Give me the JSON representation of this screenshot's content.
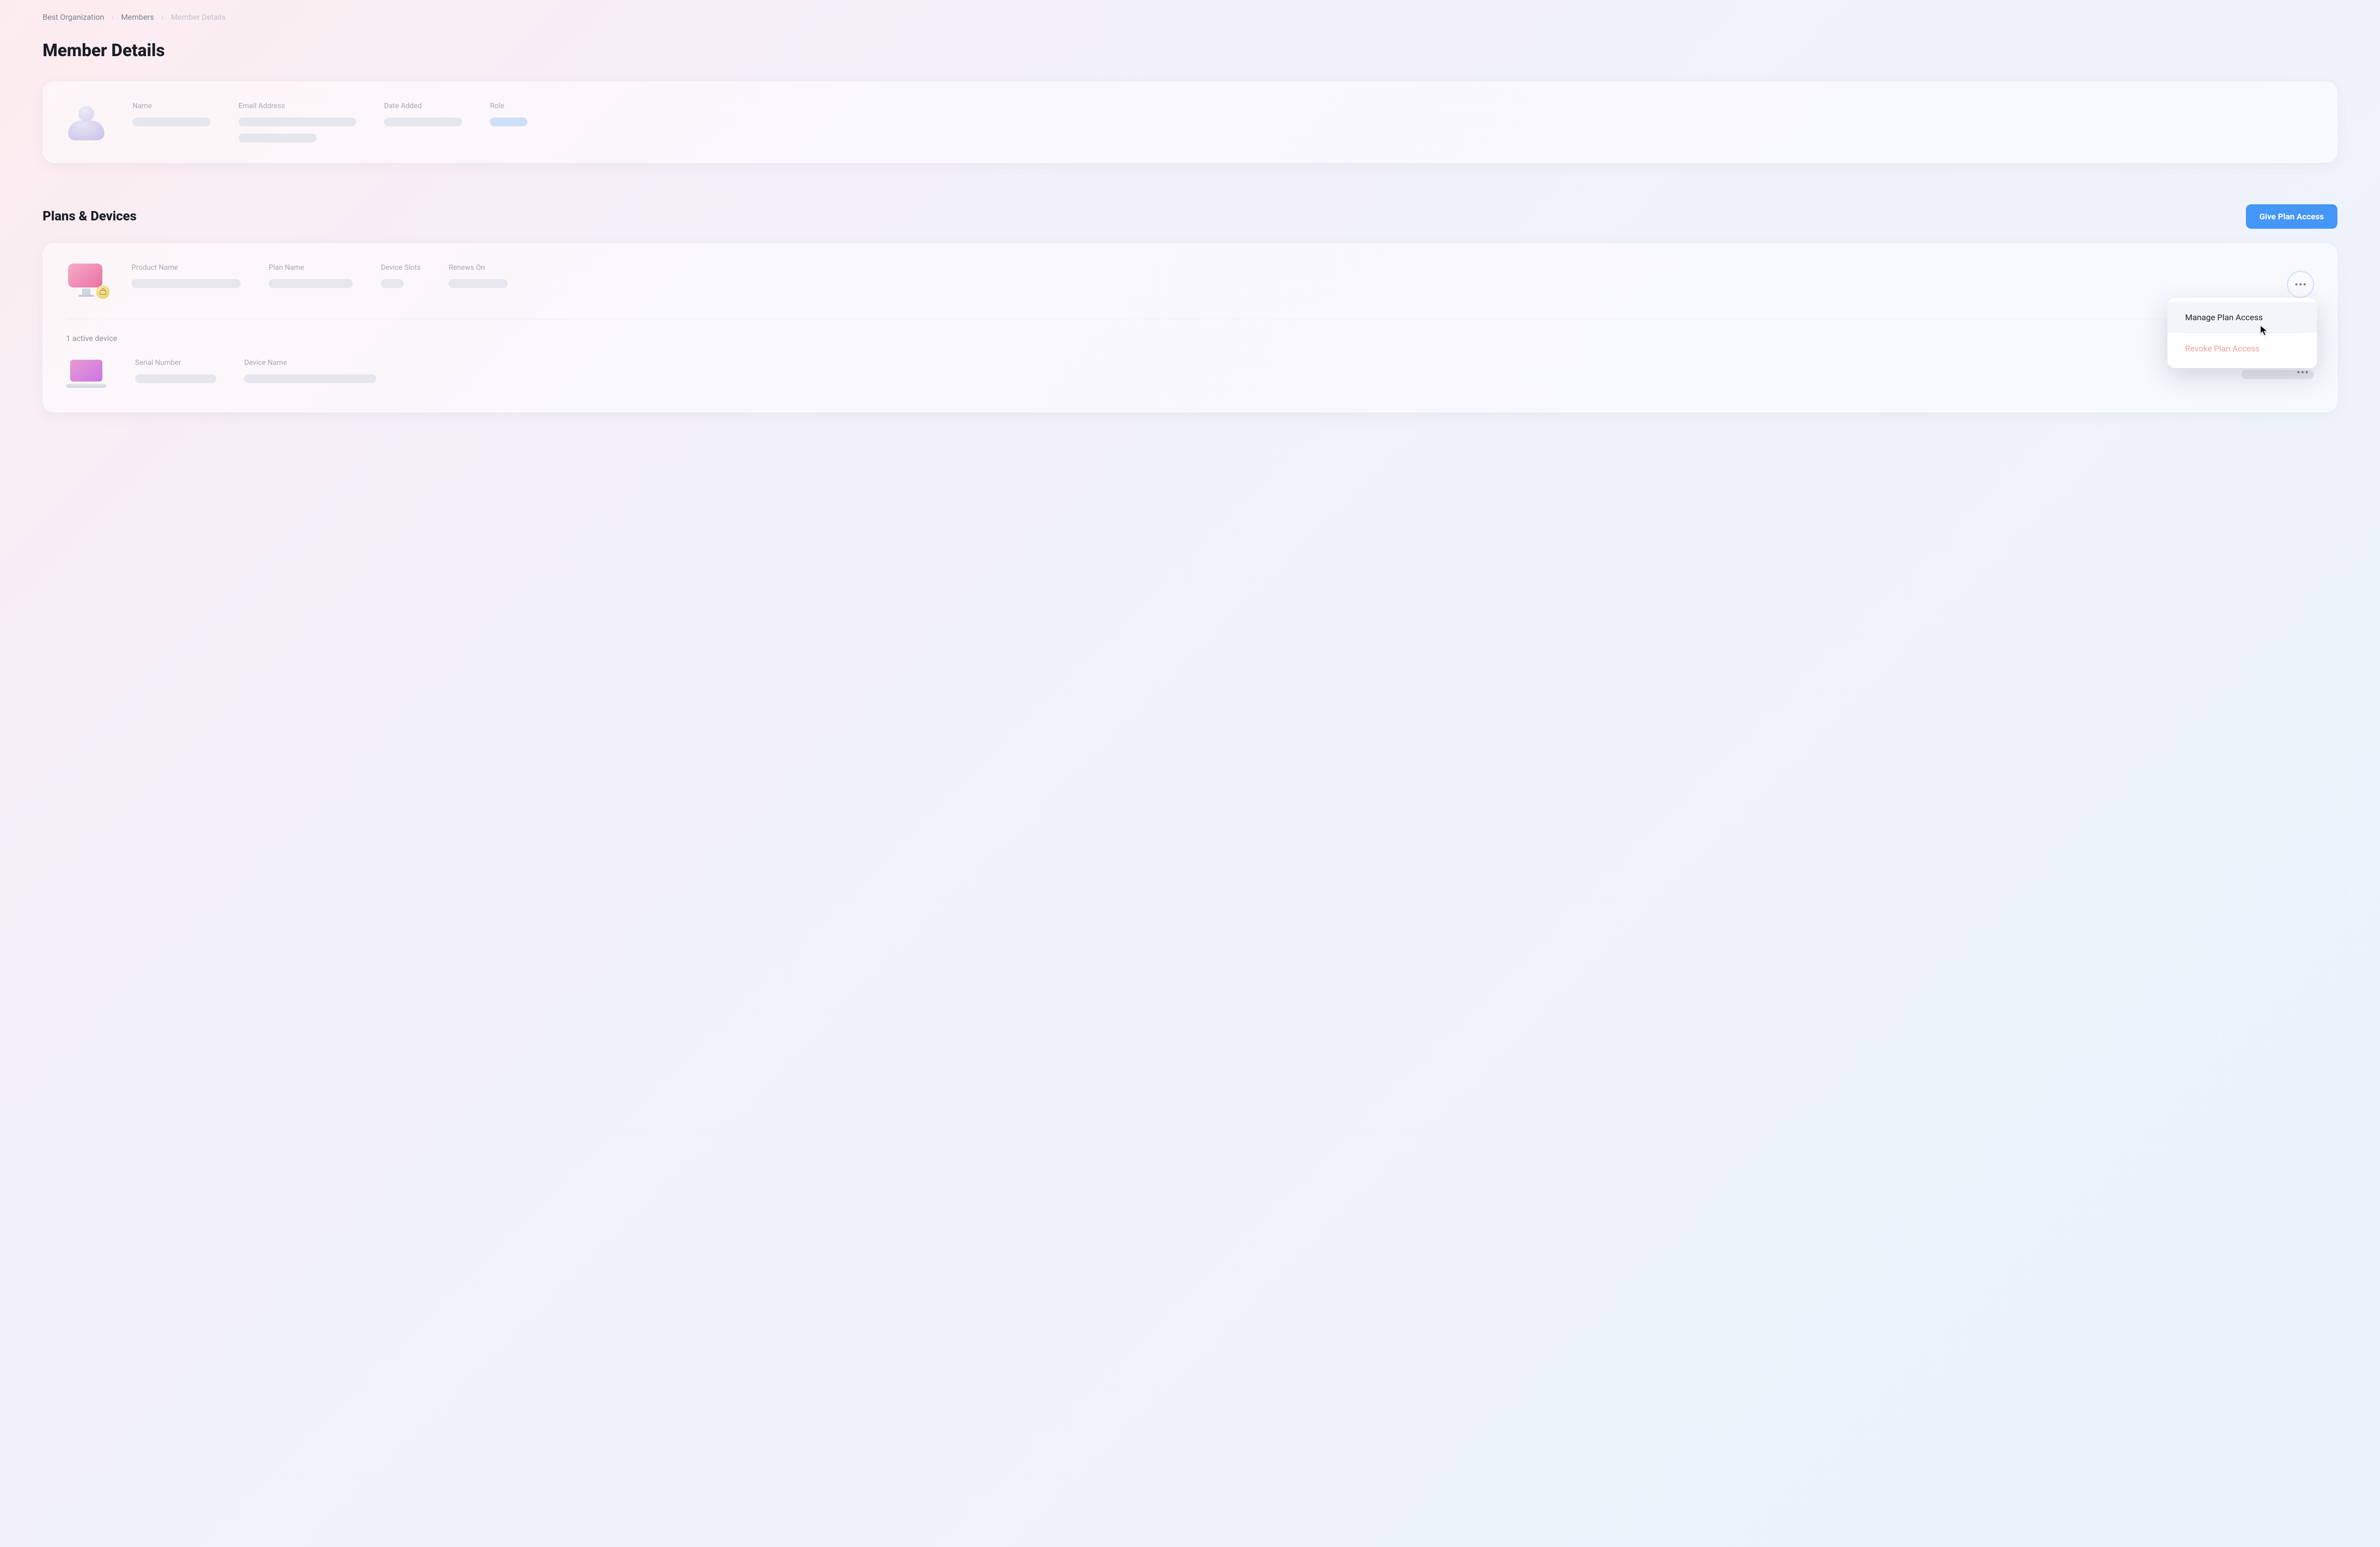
{
  "breadcrumb": {
    "org": "Best Organization",
    "members": "Members",
    "current": "Member Details"
  },
  "page_title": "Member Details",
  "member_fields": {
    "name_label": "Name",
    "email_label": "Email Address",
    "date_label": "Date Added",
    "role_label": "Role"
  },
  "section": {
    "title": "Plans & Devices",
    "give_access": "Give Plan Access"
  },
  "plan_fields": {
    "product_label": "Product Name",
    "plan_label": "Plan Name",
    "slots_label": "Device Slots",
    "renews_label": "Renews On"
  },
  "devices": {
    "active_text": "1 active device",
    "serial_label": "Serial Number",
    "device_name_label": "Device Name"
  },
  "menu": {
    "manage": "Manage Plan Access",
    "revoke": "Revoke Plan Access"
  }
}
